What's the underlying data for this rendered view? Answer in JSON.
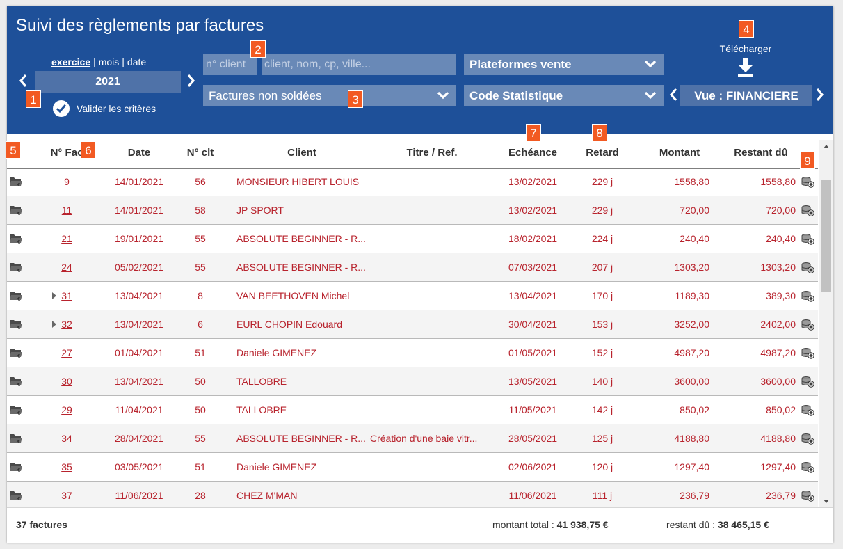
{
  "header": {
    "title": "Suivi des règlements par factures",
    "periods": [
      "exercice",
      "mois",
      "date"
    ],
    "year": "2021",
    "validate_label": "Valider les critères",
    "client_number_placeholder": "n° client",
    "client_search_placeholder": "client, nom, cp, ville...",
    "platforms_label": "Plateformes vente",
    "invoice_filter_label": "Factures non soldées",
    "stat_code_label": "Code Statistique",
    "view_label": "Vue : FINANCIERE",
    "download_label": "Télécharger"
  },
  "badges": [
    "1",
    "2",
    "3",
    "4",
    "5",
    "6",
    "7",
    "8",
    "9"
  ],
  "table": {
    "headers": [
      "N° Fac",
      "Date",
      "N° clt",
      "Client",
      "Titre / Ref.",
      "Echéance",
      "Retard",
      "Montant",
      "Restant dû"
    ],
    "rows": [
      {
        "fac": "9",
        "date": "14/01/2021",
        "clt": "56",
        "client": "MONSIEUR HIBERT LOUIS",
        "titre": "",
        "echeance": "13/02/2021",
        "retard": "229 j",
        "montant": "1558,80",
        "restant": "1558,80",
        "expand": false
      },
      {
        "fac": "11",
        "date": "14/01/2021",
        "clt": "58",
        "client": "JP SPORT",
        "titre": "",
        "echeance": "13/02/2021",
        "retard": "229 j",
        "montant": "720,00",
        "restant": "720,00",
        "expand": false
      },
      {
        "fac": "21",
        "date": "19/01/2021",
        "clt": "55",
        "client": "ABSOLUTE BEGINNER - R...",
        "titre": "",
        "echeance": "18/02/2021",
        "retard": "224 j",
        "montant": "240,40",
        "restant": "240,40",
        "expand": false
      },
      {
        "fac": "24",
        "date": "05/02/2021",
        "clt": "55",
        "client": "ABSOLUTE BEGINNER - R...",
        "titre": "",
        "echeance": "07/03/2021",
        "retard": "207 j",
        "montant": "1303,20",
        "restant": "1303,20",
        "expand": false
      },
      {
        "fac": "31",
        "date": "13/04/2021",
        "clt": "8",
        "client": "VAN BEETHOVEN Michel",
        "titre": "",
        "echeance": "13/04/2021",
        "retard": "170 j",
        "montant": "1189,30",
        "restant": "389,30",
        "expand": true
      },
      {
        "fac": "32",
        "date": "13/04/2021",
        "clt": "6",
        "client": "EURL CHOPIN Edouard",
        "titre": "",
        "echeance": "30/04/2021",
        "retard": "153 j",
        "montant": "3252,00",
        "restant": "2402,00",
        "expand": true
      },
      {
        "fac": "27",
        "date": "01/04/2021",
        "clt": "51",
        "client": "Daniele GIMENEZ",
        "titre": "",
        "echeance": "01/05/2021",
        "retard": "152 j",
        "montant": "4987,20",
        "restant": "4987,20",
        "expand": false
      },
      {
        "fac": "30",
        "date": "13/04/2021",
        "clt": "50",
        "client": "TALLOBRE",
        "titre": "",
        "echeance": "13/05/2021",
        "retard": "140 j",
        "montant": "3600,00",
        "restant": "3600,00",
        "expand": false
      },
      {
        "fac": "29",
        "date": "11/04/2021",
        "clt": "50",
        "client": "TALLOBRE",
        "titre": "",
        "echeance": "11/05/2021",
        "retard": "142 j",
        "montant": "850,02",
        "restant": "850,02",
        "expand": false
      },
      {
        "fac": "34",
        "date": "28/04/2021",
        "clt": "55",
        "client": "ABSOLUTE BEGINNER - R...",
        "titre": "Création d'une baie vitr...",
        "echeance": "28/05/2021",
        "retard": "125 j",
        "montant": "4188,80",
        "restant": "4188,80",
        "expand": false
      },
      {
        "fac": "35",
        "date": "03/05/2021",
        "clt": "51",
        "client": "Daniele GIMENEZ",
        "titre": "",
        "echeance": "02/06/2021",
        "retard": "120 j",
        "montant": "1297,40",
        "restant": "1297,40",
        "expand": false
      },
      {
        "fac": "37",
        "date": "11/06/2021",
        "clt": "28",
        "client": "CHEZ M'MAN",
        "titre": "",
        "echeance": "11/06/2021",
        "retard": "111 j",
        "montant": "236,79",
        "restant": "236,79",
        "expand": false
      }
    ]
  },
  "footer": {
    "count": "37 factures",
    "total_label": "montant total :",
    "total_value": "41 938,75 €",
    "remaining_label": "restant dû :",
    "remaining_value": "38 465,15 €"
  },
  "colors": {
    "header_bg": "#1e5099",
    "field_bg": "#6989b7",
    "badge": "#f25a22",
    "row_text": "#b8232d"
  }
}
